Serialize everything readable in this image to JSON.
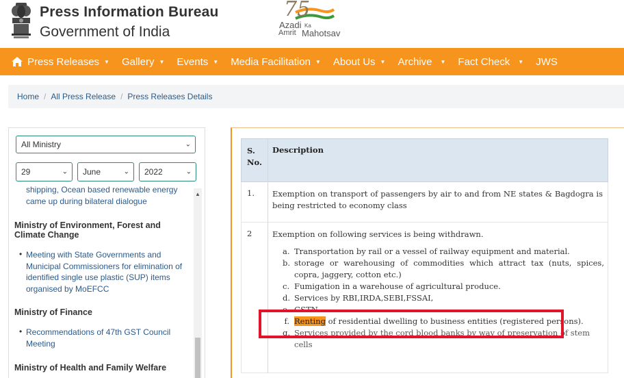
{
  "header": {
    "title": "Press Information Bureau",
    "subtitle": "Government of India",
    "campaign_logo": {
      "number": "75",
      "line1": "Azadi",
      "line1_small": "Ka",
      "line2_small": "Amrit",
      "line2": "Mahotsav"
    }
  },
  "nav": {
    "items": [
      {
        "label": "Press Releases",
        "has_dropdown": true,
        "icon": "home-icon"
      },
      {
        "label": "Gallery",
        "has_dropdown": true
      },
      {
        "label": "Events",
        "has_dropdown": true
      },
      {
        "label": "Media Facilitation",
        "has_dropdown": true
      },
      {
        "label": "About Us",
        "has_dropdown": true
      },
      {
        "label": "Archive",
        "has_dropdown": true
      },
      {
        "label": "Fact Check",
        "has_dropdown": true
      },
      {
        "label": "JWS",
        "has_dropdown": false
      }
    ],
    "color": "#f7941d"
  },
  "breadcrumb": [
    "Home",
    "All Press Release",
    "Press Releases Details"
  ],
  "sidebar": {
    "ministry_select": "All Ministry",
    "day_select": "29",
    "month_select": "June",
    "year_select": "2022",
    "partial_top_line1": "shipping, Ocean based renewable energy",
    "partial_top_line2": "came up during bilateral dialogue",
    "groups": [
      {
        "ministry": "Ministry of Environment, Forest and Climate Change",
        "items": [
          "Meeting with State Governments and Municipal Commissioners for elimination of identified single use plastic (SUP) items organised by MoEFCC"
        ]
      },
      {
        "ministry": "Ministry of Finance",
        "items": [
          "Recommendations of 47th GST Council Meeting"
        ]
      },
      {
        "ministry": "Ministry of Health and Family Welfare",
        "items": []
      }
    ]
  },
  "table": {
    "headers": {
      "sno": "S. No.",
      "description": "Description"
    },
    "rows": [
      {
        "sno": "1.",
        "description": "Exemption on transport of passengers by air to and from NE states & Bagdogra is being restricted to economy class"
      },
      {
        "sno": "2",
        "description": "Exemption on following services is being withdrawn.",
        "sub_items": [
          {
            "letter": "a.",
            "text": "Transportation by rail or a vessel of railway equipment and material."
          },
          {
            "letter": "b.",
            "text": "storage or warehousing of commodities which attract tax (nuts, spices, copra, jaggery, cotton etc.)"
          },
          {
            "letter": "c.",
            "text": "Fumigation in a warehouse of agricultural produce."
          },
          {
            "letter": "d.",
            "text": "Services by RBI,IRDA,SEBI,FSSAI,"
          },
          {
            "letter": "e.",
            "text": "GSTN."
          },
          {
            "letter": "f.",
            "highlight": "Renting",
            "text": " of residential dwelling to business entities (registered persons)."
          },
          {
            "letter": "g.",
            "text": "Services provided by the cord blood banks by way of preservation of stem cells"
          }
        ]
      }
    ]
  },
  "highlight_color": "#f7941d",
  "annotation_color": "#e0142a"
}
